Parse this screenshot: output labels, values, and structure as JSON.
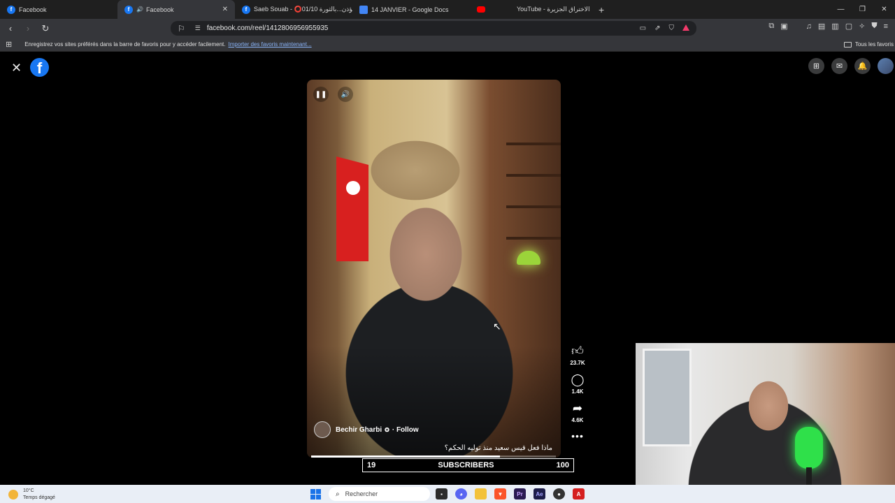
{
  "browser": {
    "tabs": [
      {
        "title": "Facebook",
        "icon": "facebook-icon",
        "active": false
      },
      {
        "title": "Facebook",
        "icon": "facebook-icon",
        "active": true,
        "audio": true
      },
      {
        "title": "Saeb Souab - ⭕01/10 مؤذن...بالثورة",
        "icon": "facebook-icon",
        "active": false
      },
      {
        "title": "14 JANVIER - Google Docs",
        "icon": "google-docs-icon",
        "active": false
      },
      {
        "title": "YouTube - الاختراق الجزيرة",
        "icon": "youtube-icon",
        "active": false
      }
    ],
    "url": "facebook.com/reel/1412806956955935",
    "bookmarks_bar": {
      "message": "Enregistrez vos sites préférés dans la barre de favoris pour y accéder facilement.",
      "import_link": "Importer des favoris maintenant...",
      "all_favorites": "Tous les favoris"
    }
  },
  "reel": {
    "author": "Bechir Gharbi",
    "follow_label": "Follow",
    "caption": "ماذا فعل قيس سعيد منذ توليه الحكم؟",
    "progress": 0.77,
    "likes": "23.7K",
    "comments": "1.4K",
    "shares": "4.6K"
  },
  "overlay": {
    "subscribers_current": "19",
    "subscribers_label": "SUBSCRIBERS",
    "subscribers_goal": "100"
  },
  "taskbar": {
    "temperature": "10°C",
    "weather": "Temps dégagé",
    "search_placeholder": "Rechercher",
    "apps": [
      "file-explorer-icon",
      "discord-icon",
      "folder-icon",
      "brave-icon",
      "premiere-pro-icon",
      "after-effects-icon",
      "app-icon",
      "acrobat-icon"
    ]
  },
  "colors": {
    "facebook_blue": "#1877f2",
    "browser_dark": "#1f1f1f",
    "toolbar": "#35363a",
    "taskbar": "#e9eef6",
    "link": "#8ab4f8"
  }
}
